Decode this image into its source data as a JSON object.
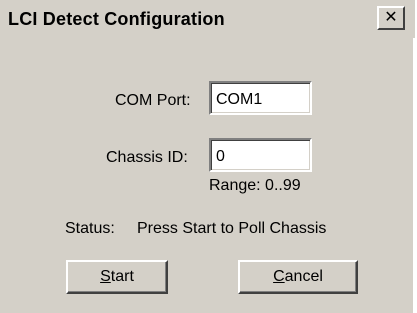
{
  "window": {
    "title": "LCI Detect Configuration",
    "close_glyph": "✕"
  },
  "com_port": {
    "label": "COM Port:",
    "value": "COM1"
  },
  "chassis_id": {
    "label": "Chassis ID:",
    "value": "0",
    "range_text": "Range: 0..99"
  },
  "status": {
    "label": "Status:",
    "message": "Press Start to Poll Chassis"
  },
  "buttons": {
    "start": {
      "mnemonic": "S",
      "rest": "tart"
    },
    "cancel": {
      "mnemonic": "C",
      "rest": "ancel"
    }
  }
}
